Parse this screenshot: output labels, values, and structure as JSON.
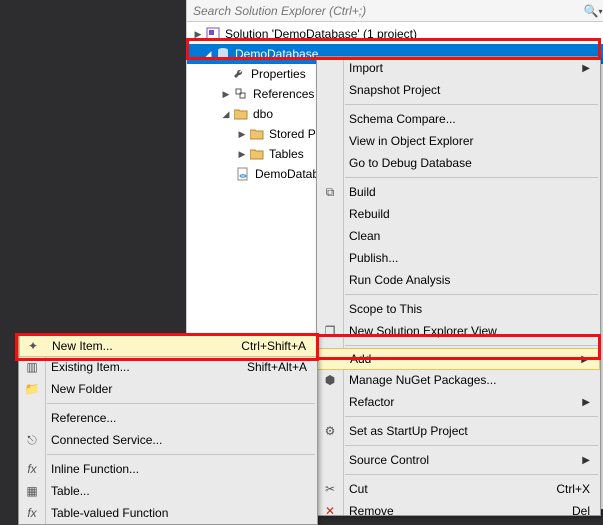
{
  "search": {
    "placeholder": "Search Solution Explorer (Ctrl+;)"
  },
  "tree": {
    "solution": "Solution 'DemoDatabase' (1 project)",
    "project": "DemoDatabase",
    "nodes": {
      "properties": "Properties",
      "references": "References",
      "dbo": "dbo",
      "storedp": "Stored P",
      "tables": "Tables",
      "demodatab": "DemoDatab"
    }
  },
  "ctx1": {
    "import": "Import",
    "snapshot": "Snapshot Project",
    "schema": "Schema Compare...",
    "viewobj": "View in Object Explorer",
    "godebug": "Go to Debug Database",
    "build": "Build",
    "rebuild": "Rebuild",
    "clean": "Clean",
    "publish": "Publish...",
    "runcode": "Run Code Analysis",
    "scope": "Scope to This",
    "newview": "New Solution Explorer View",
    "add": "Add",
    "nuget": "Manage NuGet Packages...",
    "refactor": "Refactor",
    "startup": "Set as StartUp Project",
    "source": "Source Control",
    "cut": "Cut",
    "cut_sc": "Ctrl+X",
    "remove": "Remove",
    "remove_sc": "Del"
  },
  "ctx2": {
    "newitem": "New Item...",
    "newitem_sc": "Ctrl+Shift+A",
    "existing": "Existing Item...",
    "existing_sc": "Shift+Alt+A",
    "newfolder": "New Folder",
    "reference": "Reference...",
    "connected": "Connected Service...",
    "inline": "Inline Function...",
    "table": "Table...",
    "tvf": "Table-valued Function"
  }
}
